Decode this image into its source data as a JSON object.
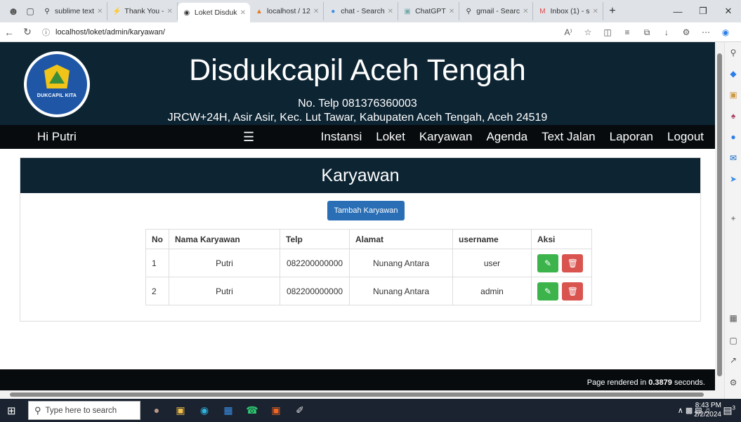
{
  "browser": {
    "tabs": [
      {
        "label": "sublime text",
        "icon": "search-icon",
        "active": false
      },
      {
        "label": "Thank You -",
        "icon": "sublime-icon",
        "active": false
      },
      {
        "label": "Loket Disduk",
        "icon": "globe-icon",
        "active": true
      },
      {
        "label": "localhost / 12",
        "icon": "phpmyadmin-icon",
        "active": false
      },
      {
        "label": "chat - Search",
        "icon": "copilot-icon",
        "active": false
      },
      {
        "label": "ChatGPT",
        "icon": "chatgpt-icon",
        "active": false
      },
      {
        "label": "gmail - Searc",
        "icon": "search-icon",
        "active": false
      },
      {
        "label": "Inbox (1) - s",
        "icon": "gmail-icon",
        "active": false
      }
    ],
    "url": "localhost/loket/admin/karyawan/"
  },
  "header": {
    "logo_text": "DUKCAPIL KITA",
    "title": "Disdukcapil Aceh Tengah",
    "phone": "No. Telp 081376360003",
    "address": "JRCW+24H, Asir Asir, Kec. Lut Tawar, Kabupaten Aceh Tengah, Aceh 24519"
  },
  "navbar": {
    "greeting": "Hi Putri",
    "links": [
      "Instansi",
      "Loket",
      "Karyawan",
      "Agenda",
      "Text Jalan",
      "Laporan",
      "Logout"
    ]
  },
  "content": {
    "heading": "Karyawan",
    "add_button": "Tambah Karyawan",
    "table": {
      "headers": [
        "No",
        "Nama Karyawan",
        "Telp",
        "Alamat",
        "username",
        "Aksi"
      ],
      "rows": [
        {
          "no": "1",
          "nama": "Putri",
          "telp": "082200000000",
          "alamat": "Nunang Antara",
          "username": "user"
        },
        {
          "no": "2",
          "nama": "Putri",
          "telp": "082200000000",
          "alamat": "Nunang Antara",
          "username": "admin"
        }
      ]
    }
  },
  "footer": {
    "prefix": "Page rendered in ",
    "seconds": "0.3879",
    "suffix": " seconds."
  },
  "taskbar": {
    "search_placeholder": "Type here to search",
    "time": "8:43 PM",
    "date": "2/2/2024",
    "notification_count": "3"
  },
  "colors": {
    "header_bg": "#0d2433",
    "navbar_bg": "#070b0e",
    "primary_button": "#2a6fb5",
    "edit_button": "#3cb44b",
    "delete_button": "#d9534f"
  }
}
